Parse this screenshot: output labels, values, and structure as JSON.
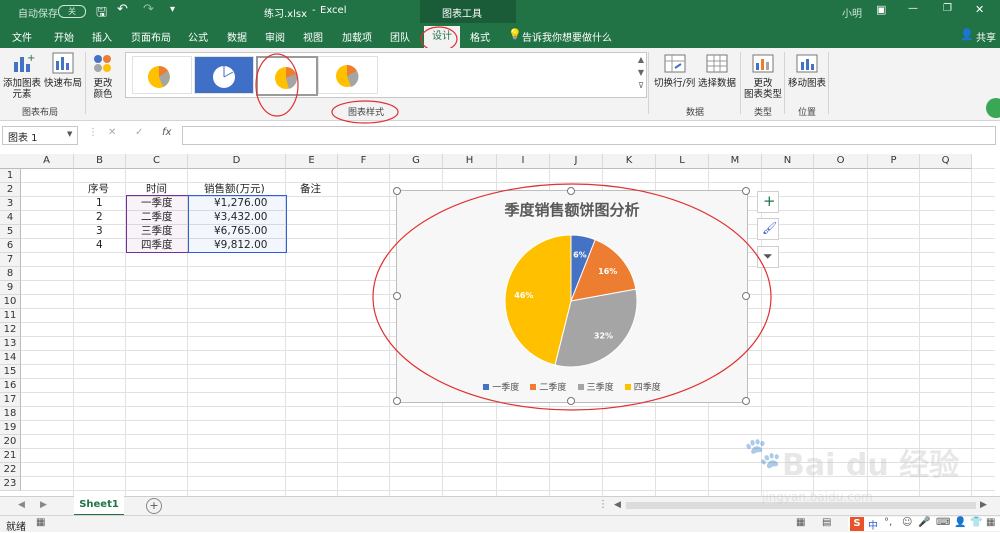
{
  "titlebar": {
    "autosave_label": "自动保存",
    "autosave_state": "关",
    "filename": "练习.xlsx",
    "separator": "-",
    "app": "Excel",
    "context_tools": "图表工具",
    "user": "小明"
  },
  "tabs": [
    "文件",
    "开始",
    "插入",
    "页面布局",
    "公式",
    "数据",
    "审阅",
    "视图",
    "加载项",
    "团队",
    "设计",
    "格式"
  ],
  "tell_me": "告诉我你想要做什么",
  "share": "共享",
  "ribbon": {
    "add_element": "添加图表\n元素",
    "quick_layout": "快速布局",
    "change_colors": "更改\n颜色",
    "group_layout": "图表布局",
    "group_styles": "图表样式",
    "switch_rowcol": "切换行/列",
    "select_data": "选择数据",
    "group_data": "数据",
    "change_type": "更改\n图表类型",
    "group_type": "类型",
    "move_chart": "移动图表",
    "group_location": "位置"
  },
  "namebox": "图表 1",
  "fx": "fx",
  "columns": [
    "A",
    "B",
    "C",
    "D",
    "E",
    "F",
    "G",
    "H",
    "I",
    "J",
    "K",
    "L",
    "M",
    "N",
    "O",
    "P",
    "Q"
  ],
  "rows": [
    "1",
    "2",
    "3",
    "4",
    "5",
    "6",
    "7",
    "8",
    "9",
    "10",
    "11",
    "12",
    "13",
    "14",
    "15",
    "16",
    "17",
    "18",
    "19",
    "20",
    "21",
    "22",
    "23"
  ],
  "table": {
    "headers": [
      "序号",
      "时间",
      "销售额(万元)"
    ],
    "note_header": "备注",
    "rows": [
      [
        "1",
        "一季度",
        "¥1,276.00"
      ],
      [
        "2",
        "二季度",
        "¥3,432.00"
      ],
      [
        "3",
        "三季度",
        "¥6,765.00"
      ],
      [
        "4",
        "四季度",
        "¥9,812.00"
      ]
    ]
  },
  "chart_data": {
    "type": "pie",
    "title": "季度销售额饼图分析",
    "categories": [
      "一季度",
      "二季度",
      "三季度",
      "四季度"
    ],
    "values": [
      1276,
      3432,
      6765,
      9812
    ],
    "data_labels": [
      "6%",
      "16%",
      "32%",
      "46%"
    ],
    "colors": [
      "#4472C4",
      "#ED7D31",
      "#A5A5A5",
      "#FFC000"
    ],
    "legend_position": "bottom"
  },
  "sheet_tab": "Sheet1",
  "status": "就绪",
  "watermark": {
    "brand": "Bai du 经验",
    "url": "jingyan.baidu.com"
  },
  "colors": {
    "excel_green": "#217346",
    "annotation_red": "#e03030",
    "selection_purple": "#7030A0",
    "selection_blue": "#2f5fd0"
  }
}
